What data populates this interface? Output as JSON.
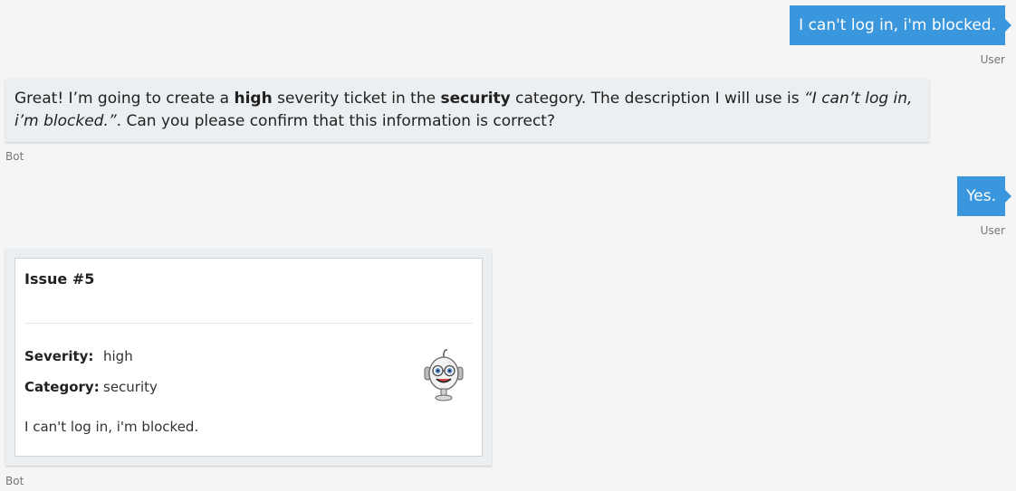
{
  "messages": [
    {
      "from": "User",
      "text": "I can't log in, i'm blocked."
    },
    {
      "from": "Bot",
      "text_parts": {
        "p1": "Great! I’m going to create a ",
        "severity": "high",
        "p2": " severity ticket in the ",
        "category": "security",
        "p3": " category. The description I will use is ",
        "description": "“I can’t log in, i’m blocked.”",
        "p4": ". Can you please confirm that this information is correct?"
      }
    },
    {
      "from": "User",
      "text": "Yes."
    },
    {
      "from": "Bot",
      "card": {
        "title": "Issue #5",
        "facts": [
          {
            "key": "Severity:",
            "value": "high"
          },
          {
            "key": "Category:",
            "value": "security"
          }
        ],
        "description": "I can't log in, i'm blocked.",
        "image_icon": "bot-avatar-icon"
      }
    }
  ],
  "colors": {
    "user_bubble": "#3a96dd",
    "bot_bubble": "#eceff1",
    "background": "#f5f5f5"
  }
}
